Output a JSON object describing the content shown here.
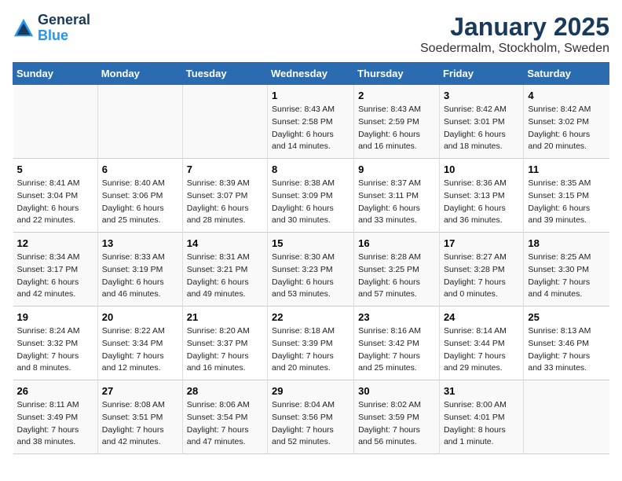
{
  "header": {
    "logo_line1": "General",
    "logo_line2": "Blue",
    "title": "January 2025",
    "subtitle": "Soedermalm, Stockholm, Sweden"
  },
  "weekdays": [
    "Sunday",
    "Monday",
    "Tuesday",
    "Wednesday",
    "Thursday",
    "Friday",
    "Saturday"
  ],
  "weeks": [
    [
      {
        "day": "",
        "info": ""
      },
      {
        "day": "",
        "info": ""
      },
      {
        "day": "",
        "info": ""
      },
      {
        "day": "1",
        "info": "Sunrise: 8:43 AM\nSunset: 2:58 PM\nDaylight: 6 hours\nand 14 minutes."
      },
      {
        "day": "2",
        "info": "Sunrise: 8:43 AM\nSunset: 2:59 PM\nDaylight: 6 hours\nand 16 minutes."
      },
      {
        "day": "3",
        "info": "Sunrise: 8:42 AM\nSunset: 3:01 PM\nDaylight: 6 hours\nand 18 minutes."
      },
      {
        "day": "4",
        "info": "Sunrise: 8:42 AM\nSunset: 3:02 PM\nDaylight: 6 hours\nand 20 minutes."
      }
    ],
    [
      {
        "day": "5",
        "info": "Sunrise: 8:41 AM\nSunset: 3:04 PM\nDaylight: 6 hours\nand 22 minutes."
      },
      {
        "day": "6",
        "info": "Sunrise: 8:40 AM\nSunset: 3:06 PM\nDaylight: 6 hours\nand 25 minutes."
      },
      {
        "day": "7",
        "info": "Sunrise: 8:39 AM\nSunset: 3:07 PM\nDaylight: 6 hours\nand 28 minutes."
      },
      {
        "day": "8",
        "info": "Sunrise: 8:38 AM\nSunset: 3:09 PM\nDaylight: 6 hours\nand 30 minutes."
      },
      {
        "day": "9",
        "info": "Sunrise: 8:37 AM\nSunset: 3:11 PM\nDaylight: 6 hours\nand 33 minutes."
      },
      {
        "day": "10",
        "info": "Sunrise: 8:36 AM\nSunset: 3:13 PM\nDaylight: 6 hours\nand 36 minutes."
      },
      {
        "day": "11",
        "info": "Sunrise: 8:35 AM\nSunset: 3:15 PM\nDaylight: 6 hours\nand 39 minutes."
      }
    ],
    [
      {
        "day": "12",
        "info": "Sunrise: 8:34 AM\nSunset: 3:17 PM\nDaylight: 6 hours\nand 42 minutes."
      },
      {
        "day": "13",
        "info": "Sunrise: 8:33 AM\nSunset: 3:19 PM\nDaylight: 6 hours\nand 46 minutes."
      },
      {
        "day": "14",
        "info": "Sunrise: 8:31 AM\nSunset: 3:21 PM\nDaylight: 6 hours\nand 49 minutes."
      },
      {
        "day": "15",
        "info": "Sunrise: 8:30 AM\nSunset: 3:23 PM\nDaylight: 6 hours\nand 53 minutes."
      },
      {
        "day": "16",
        "info": "Sunrise: 8:28 AM\nSunset: 3:25 PM\nDaylight: 6 hours\nand 57 minutes."
      },
      {
        "day": "17",
        "info": "Sunrise: 8:27 AM\nSunset: 3:28 PM\nDaylight: 7 hours\nand 0 minutes."
      },
      {
        "day": "18",
        "info": "Sunrise: 8:25 AM\nSunset: 3:30 PM\nDaylight: 7 hours\nand 4 minutes."
      }
    ],
    [
      {
        "day": "19",
        "info": "Sunrise: 8:24 AM\nSunset: 3:32 PM\nDaylight: 7 hours\nand 8 minutes."
      },
      {
        "day": "20",
        "info": "Sunrise: 8:22 AM\nSunset: 3:34 PM\nDaylight: 7 hours\nand 12 minutes."
      },
      {
        "day": "21",
        "info": "Sunrise: 8:20 AM\nSunset: 3:37 PM\nDaylight: 7 hours\nand 16 minutes."
      },
      {
        "day": "22",
        "info": "Sunrise: 8:18 AM\nSunset: 3:39 PM\nDaylight: 7 hours\nand 20 minutes."
      },
      {
        "day": "23",
        "info": "Sunrise: 8:16 AM\nSunset: 3:42 PM\nDaylight: 7 hours\nand 25 minutes."
      },
      {
        "day": "24",
        "info": "Sunrise: 8:14 AM\nSunset: 3:44 PM\nDaylight: 7 hours\nand 29 minutes."
      },
      {
        "day": "25",
        "info": "Sunrise: 8:13 AM\nSunset: 3:46 PM\nDaylight: 7 hours\nand 33 minutes."
      }
    ],
    [
      {
        "day": "26",
        "info": "Sunrise: 8:11 AM\nSunset: 3:49 PM\nDaylight: 7 hours\nand 38 minutes."
      },
      {
        "day": "27",
        "info": "Sunrise: 8:08 AM\nSunset: 3:51 PM\nDaylight: 7 hours\nand 42 minutes."
      },
      {
        "day": "28",
        "info": "Sunrise: 8:06 AM\nSunset: 3:54 PM\nDaylight: 7 hours\nand 47 minutes."
      },
      {
        "day": "29",
        "info": "Sunrise: 8:04 AM\nSunset: 3:56 PM\nDaylight: 7 hours\nand 52 minutes."
      },
      {
        "day": "30",
        "info": "Sunrise: 8:02 AM\nSunset: 3:59 PM\nDaylight: 7 hours\nand 56 minutes."
      },
      {
        "day": "31",
        "info": "Sunrise: 8:00 AM\nSunset: 4:01 PM\nDaylight: 8 hours\nand 1 minute."
      },
      {
        "day": "",
        "info": ""
      }
    ]
  ]
}
